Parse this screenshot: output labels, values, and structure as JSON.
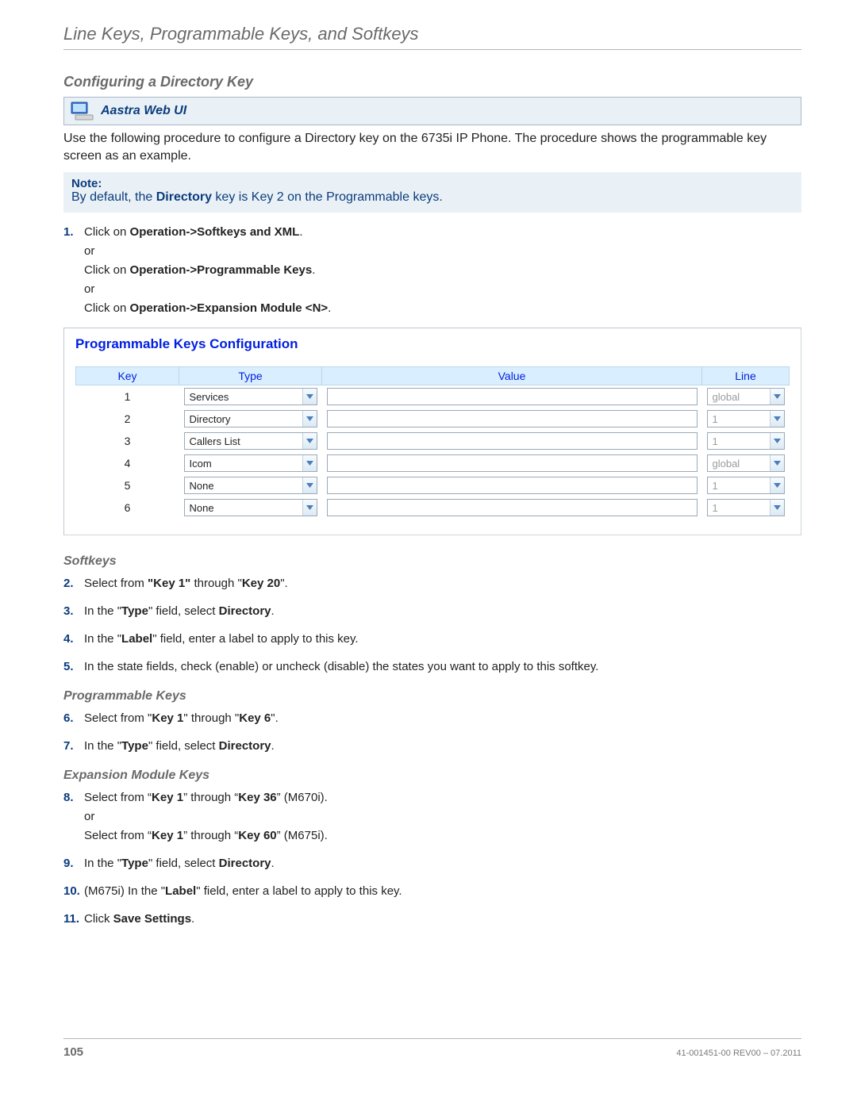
{
  "chapter": "Line Keys, Programmable Keys, and Softkeys",
  "section": "Configuring a Directory Key",
  "webui_label": "Aastra Web UI",
  "intro": "Use the following procedure to configure a Directory key on the 6735i IP Phone. The procedure shows the programmable key screen as an example.",
  "note": {
    "label": "Note:",
    "prefix": "By default, the ",
    "bold": "Directory",
    "suffix": " key is Key 2 on the Programmable keys."
  },
  "step1": {
    "num": "1.",
    "a_pre": "Click on ",
    "a_bold": "Operation->Softkeys and XML",
    "a_post": ".",
    "or1": "or",
    "b_pre": "Click on ",
    "b_bold": "Operation->Programmable Keys",
    "b_post": ".",
    "or2": "or",
    "c_pre": "Click on ",
    "c_bold": "Operation->Expansion Module <N>",
    "c_post": "."
  },
  "screenshot": {
    "title": "Programmable Keys Configuration",
    "headers": {
      "key": "Key",
      "type": "Type",
      "value": "Value",
      "line": "Line"
    },
    "rows": [
      {
        "key": "1",
        "type": "Services",
        "line": "global",
        "line_disabled": true
      },
      {
        "key": "2",
        "type": "Directory",
        "line": "1",
        "line_disabled": true
      },
      {
        "key": "3",
        "type": "Callers List",
        "line": "1",
        "line_disabled": true
      },
      {
        "key": "4",
        "type": "Icom",
        "line": "global",
        "line_disabled": true
      },
      {
        "key": "5",
        "type": "None",
        "line": "1",
        "line_disabled": true
      },
      {
        "key": "6",
        "type": "None",
        "line": "1",
        "line_disabled": true
      }
    ]
  },
  "softkeys_heading": "Softkeys",
  "step2": {
    "num": "2.",
    "pre": "Select from ",
    "b1": "\"Key 1\"",
    "mid": " through \"",
    "b2": "Key 20",
    "post": "\"."
  },
  "step3": {
    "num": "3.",
    "pre": "In the \"",
    "b1": "Type",
    "mid": "\" field, select ",
    "b2": "Directory",
    "post": "."
  },
  "step4": {
    "num": "4.",
    "pre": "In the \"",
    "b1": "Label",
    "post": "\" field, enter a label to apply to this key."
  },
  "step5": {
    "num": "5.",
    "text": "In the state fields, check (enable) or uncheck (disable) the states you want to apply to this softkey."
  },
  "progkeys_heading": "Programmable Keys",
  "step6": {
    "num": "6.",
    "pre": "Select from \"",
    "b1": "Key 1",
    "mid": "\" through \"",
    "b2": "Key 6",
    "post": "\"."
  },
  "step7": {
    "num": "7.",
    "pre": "In the \"",
    "b1": "Type",
    "mid": "\" field, select ",
    "b2": "Directory",
    "post": "."
  },
  "expkeys_heading": "Expansion Module Keys",
  "step8": {
    "num": "8.",
    "a_pre": "Select from “",
    "a_b1": "Key 1",
    "a_mid": "” through “",
    "a_b2": "Key 36",
    "a_post": "” (M670i).",
    "or": "or",
    "b_pre": "Select from “",
    "b_b1": "Key 1",
    "b_mid": "” through “",
    "b_b2": "Key 60",
    "b_post": "” (M675i)."
  },
  "step9": {
    "num": "9.",
    "pre": "In the \"",
    "b1": "Type",
    "mid": "\" field, select ",
    "b2": "Directory",
    "post": "."
  },
  "step10": {
    "num": "10.",
    "pre": "(M675i) In the \"",
    "b1": "Label",
    "post": "\" field, enter a label to apply to this key."
  },
  "step11": {
    "num": "11.",
    "pre": "Click ",
    "b1": "Save Settings",
    "post": "."
  },
  "footer": {
    "page": "105",
    "doc": "41-001451-00 REV00 – 07.2011"
  }
}
